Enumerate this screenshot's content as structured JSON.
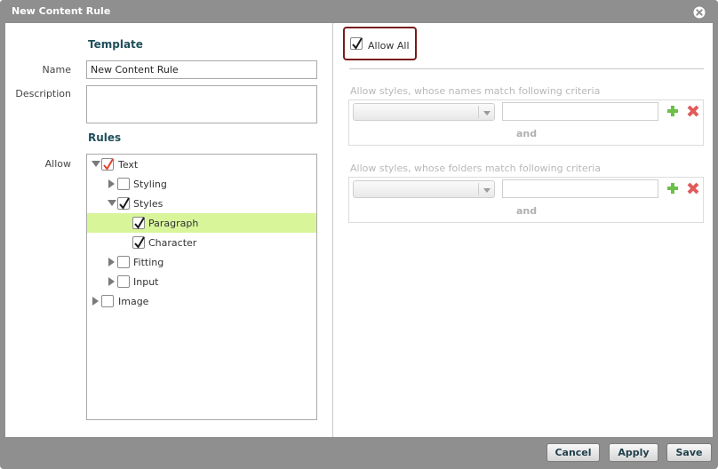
{
  "dialog": {
    "title": "New Content Rule"
  },
  "template": {
    "heading": "Template",
    "name_label": "Name",
    "name_value": "New Content Rule",
    "description_label": "Description",
    "description_value": ""
  },
  "rules": {
    "heading": "Rules",
    "allow_label": "Allow",
    "tree": [
      {
        "label": "Text",
        "level": 0,
        "expanded": true,
        "checked": true,
        "partial": true
      },
      {
        "label": "Styling",
        "level": 1,
        "expanded": false,
        "checked": false
      },
      {
        "label": "Styles",
        "level": 1,
        "expanded": true,
        "checked": true
      },
      {
        "label": "Paragraph",
        "level": 2,
        "checked": true,
        "selected": true
      },
      {
        "label": "Character",
        "level": 2,
        "checked": true
      },
      {
        "label": "Fitting",
        "level": 1,
        "expanded": false,
        "checked": false
      },
      {
        "label": "Input",
        "level": 1,
        "expanded": false,
        "checked": false
      },
      {
        "label": "Image",
        "level": 0,
        "expanded": false,
        "checked": false
      }
    ]
  },
  "allow_all": {
    "label": "Allow All",
    "checked": true
  },
  "criteria": [
    {
      "label": "Allow styles, whose names match following criteria",
      "and_label": "and",
      "select_value": "",
      "input_value": ""
    },
    {
      "label": "Allow styles, whose folders match following criteria",
      "and_label": "and",
      "select_value": "",
      "input_value": ""
    }
  ],
  "buttons": {
    "cancel": "Cancel",
    "apply": "Apply",
    "save": "Save"
  },
  "colors": {
    "title_bar": "#8f8f8f",
    "selected_row": "#d8f59a",
    "highlight_border": "#7a1b1b",
    "partial_check": "#e0452a",
    "plus_green": "#6cc04a",
    "remove_red": "#e25a5a"
  }
}
